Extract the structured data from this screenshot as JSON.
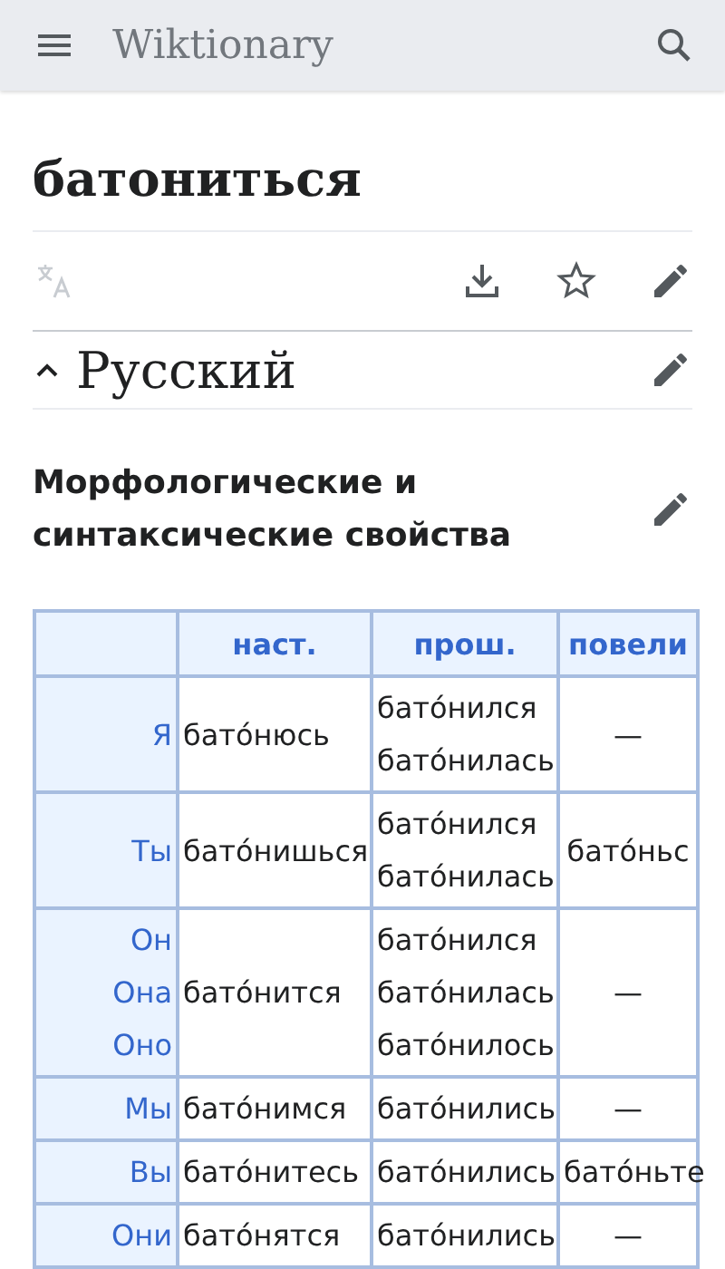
{
  "header": {
    "title": "Wiktionary"
  },
  "page": {
    "title": "батониться"
  },
  "section": {
    "title": "Русский",
    "expanded": true
  },
  "subsection": {
    "title": "Морфологические и синтаксические свойства"
  },
  "table": {
    "columns": [
      "",
      "наст.",
      "прош.",
      "повели"
    ],
    "rows": [
      {
        "pronouns": [
          "Я"
        ],
        "present": "бато́нюсь",
        "past": [
          "бато́нился",
          "бато́нилась"
        ],
        "imperative": "—"
      },
      {
        "pronouns": [
          "Ты"
        ],
        "present": "бато́нишься",
        "past": [
          "бато́нился",
          "бато́нилась"
        ],
        "imperative": "бато́ньс"
      },
      {
        "pronouns": [
          "Он",
          "Она",
          "Оно"
        ],
        "present": "бато́нится",
        "past": [
          "бато́нился",
          "бато́нилась",
          "бато́нилось"
        ],
        "imperative": "—"
      },
      {
        "pronouns": [
          "Мы"
        ],
        "present": "бато́нимся",
        "past": [
          "бато́нились"
        ],
        "imperative": "—"
      },
      {
        "pronouns": [
          "Вы"
        ],
        "present": "бато́нитесь",
        "past": [
          "бато́нились"
        ],
        "imperative": "бато́ньте"
      },
      {
        "pronouns": [
          "Они"
        ],
        "present": "бато́нятся",
        "past": [
          "бато́нились"
        ],
        "imperative": "—"
      }
    ]
  }
}
